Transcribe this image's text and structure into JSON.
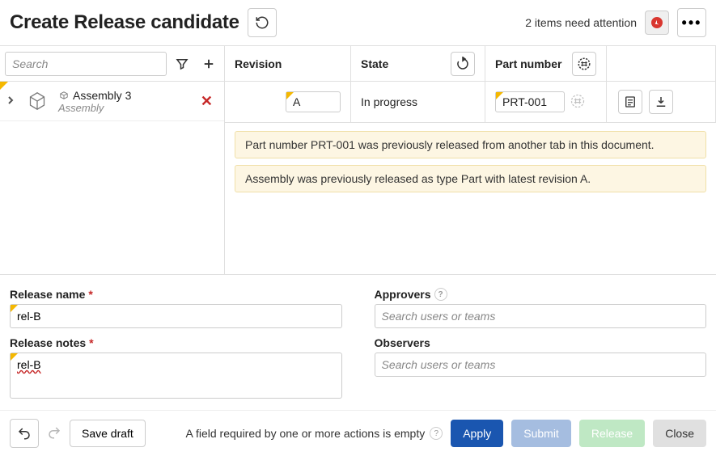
{
  "header": {
    "title": "Create Release candidate",
    "attention_text": "2 items need attention"
  },
  "left": {
    "search_placeholder": "Search",
    "tree": {
      "name": "Assembly 3",
      "type": "Assembly"
    }
  },
  "table": {
    "headers": {
      "revision": "Revision",
      "state": "State",
      "part_number": "Part number"
    },
    "row": {
      "revision": "A",
      "state": "In progress",
      "part_number": "PRT-001"
    }
  },
  "warnings": [
    "Part number PRT-001 was previously released from another tab in this document.",
    "Assembly was previously released as type Part with latest revision A."
  ],
  "form": {
    "release_name_label": "Release name",
    "release_name_value": "rel-B",
    "release_notes_label": "Release notes",
    "release_notes_value": "rel-B",
    "approvers_label": "Approvers",
    "approvers_placeholder": "Search users or teams",
    "observers_label": "Observers",
    "observers_placeholder": "Search users or teams"
  },
  "footer": {
    "save_draft": "Save draft",
    "message": "A field required by one or more actions is empty",
    "apply": "Apply",
    "submit": "Submit",
    "release": "Release",
    "close": "Close"
  }
}
